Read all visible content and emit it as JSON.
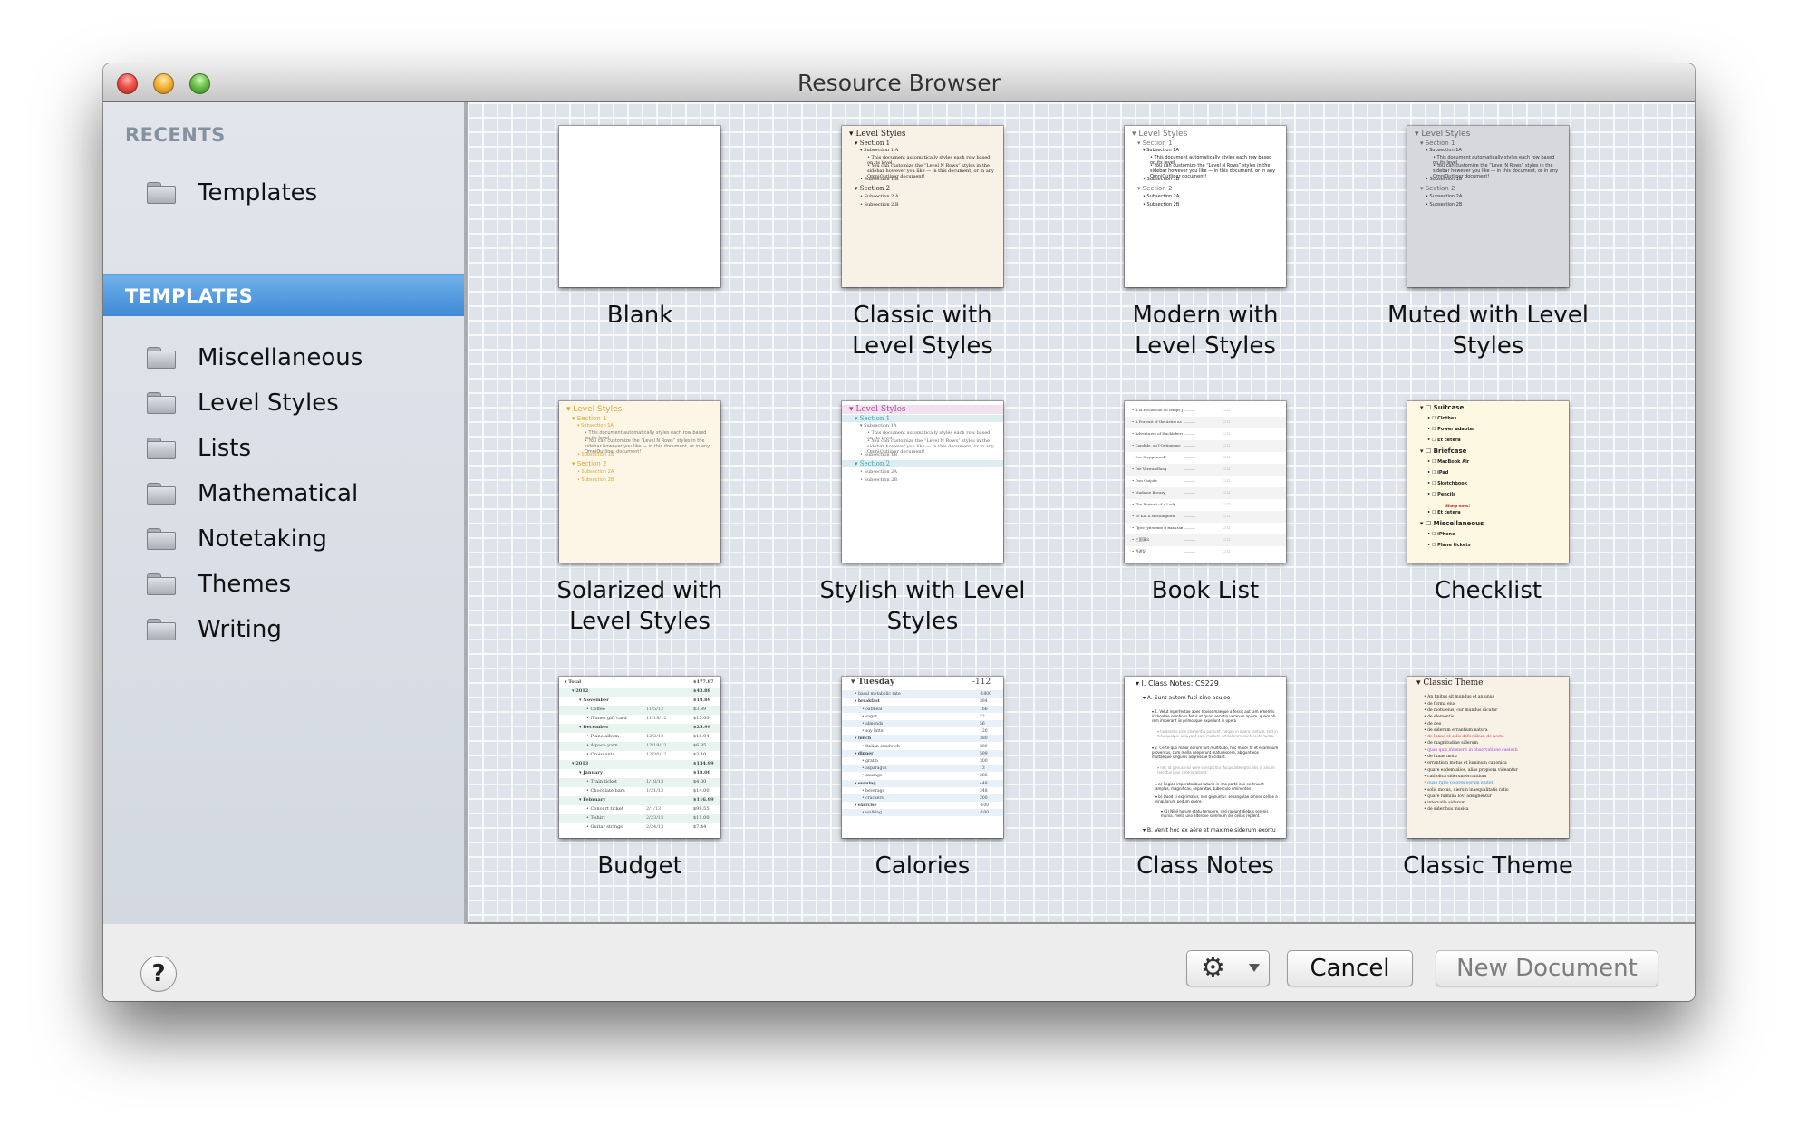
{
  "window": {
    "title": "Resource Browser"
  },
  "sidebar": {
    "recents_header": "RECENTS",
    "recents": [
      {
        "label": "Templates",
        "icon": "folder-icon"
      }
    ],
    "templates_header": "TEMPLATES",
    "templates_selected": true,
    "items": [
      {
        "label": "Miscellaneous",
        "icon": "folder-icon"
      },
      {
        "label": "Level Styles",
        "icon": "folder-icon"
      },
      {
        "label": "Lists",
        "icon": "folder-icon"
      },
      {
        "label": "Mathematical",
        "icon": "folder-icon"
      },
      {
        "label": "Notetaking",
        "icon": "folder-icon"
      },
      {
        "label": "Themes",
        "icon": "folder-icon"
      },
      {
        "label": "Writing",
        "icon": "folder-icon"
      }
    ]
  },
  "templates": [
    {
      "label": "Blank",
      "bg": "#ffffff"
    },
    {
      "label": "Classic with Level Styles",
      "bg": "#f7f1e6",
      "preview": [
        "Level Styles",
        "Section 1",
        "Subsection 1.A",
        "This document automatically styles each row based on its level.",
        "You can customize the “Level N Rows” styles in the sidebar however you like — in this document, or in any OmniOutliner document!",
        "Subsection 1.B",
        "Section 2",
        "Subsection 2.A",
        "Subsection 2.B"
      ]
    },
    {
      "label": "Modern with Level Styles",
      "bg": "#ffffff",
      "preview": [
        "Level Styles",
        "Section 1",
        "Subsection 1A",
        "This document automatically styles each row based on its level.",
        "You can customize the “Level N Rows” styles in the sidebar however you like — in this document, or in any OmniOutliner document!",
        "Subsection 1B",
        "Section 2",
        "Subsection 2A",
        "Subsection 2B"
      ]
    },
    {
      "label": "Muted with Level Styles",
      "bg": "#d6d8dc",
      "preview": [
        "Level Styles",
        "Section 1",
        "Subsection 1A",
        "This document automatically styles each row based on its level.",
        "You can customize the “Level N Rows” styles in the sidebar however you like — in this document, or in any OmniOutliner document!",
        "Subsection 1B",
        "Section 2",
        "Subsection 2A",
        "Subsection 2B"
      ]
    },
    {
      "label": "Solarized with Level Styles",
      "bg": "#fdf6e6",
      "preview": [
        "Level Styles",
        "Section 1",
        "Subsection 1A",
        "This document automatically styles each row based on its level.",
        "You can customize the “Level N Rows” styles in the sidebar however you like — in this document, or in any OmniOutliner document!",
        "Subsection 1B",
        "Section 2",
        "Subsection 2A",
        "Subsection 2B"
      ]
    },
    {
      "label": "Stylish with Level Styles",
      "bg": "#ffffff",
      "preview": [
        "Level Styles",
        "Section 1",
        "Subsection 1A",
        "This document automatically styles each row based on its level.",
        "You can customize the “Level N Rows” styles in the sidebar however you like — in this document, or in any OmniOutliner document!",
        "Subsection 1B",
        "Section 2",
        "Subsection 2A",
        "Subsection 2B"
      ]
    },
    {
      "label": "Book List",
      "bg": "#ffffff",
      "preview": [
        "À la recherche du temps perdu",
        "A Portrait of the Artist as a Young Man",
        "Adventures of Huckleberry Finn",
        "Candide, ou l'Optimisme",
        "Der Steppenwolf",
        "Die Verwandlung",
        "Don Quijote",
        "Madame Bovary",
        "The Portrait of a Lady",
        "To Kill a Mockingbird",
        "Преступление и наказание",
        "三国演义",
        "西遊記"
      ]
    },
    {
      "label": "Checklist",
      "bg": "#fdf8e1",
      "preview": [
        "Suitcase",
        "Clothes",
        "Power adapter",
        "Et cetera",
        "Briefcase",
        "MacBook Air",
        "iPad",
        "Sketchbook",
        "Pencils",
        "Sharp ones!",
        "Et cetera",
        "Miscellaneous",
        "iPhone",
        "Plane tickets"
      ]
    },
    {
      "label": "Budget",
      "bg": "#ffffff",
      "preview": [
        {
          "item": "Total",
          "date": "",
          "amount": "$177.87"
        },
        {
          "item": "2012",
          "date": "",
          "amount": "$43.88"
        },
        {
          "item": "November",
          "date": "",
          "amount": "$18.89"
        },
        {
          "item": "Coffee",
          "date": "11/5/12",
          "amount": "$3.89"
        },
        {
          "item": "iTunes gift card",
          "date": "11/18/12",
          "amount": "$15.00"
        },
        {
          "item": "December",
          "date": "",
          "amount": "$25.99"
        },
        {
          "item": "Piano album",
          "date": "12/2/12",
          "amount": "$18.04"
        },
        {
          "item": "Alpaca yarn",
          "date": "12/19/12",
          "amount": "$6.85"
        },
        {
          "item": "Croissants",
          "date": "12/30/12",
          "amount": "$3.10"
        },
        {
          "item": "2013",
          "date": "",
          "amount": "$134.99"
        },
        {
          "item": "January",
          "date": "",
          "amount": "$18.00"
        },
        {
          "item": "Train ticket",
          "date": "1/18/13",
          "amount": "$4.00"
        },
        {
          "item": "Chocolate bars",
          "date": "1/21/13",
          "amount": "$14.00"
        },
        {
          "item": "February",
          "date": "",
          "amount": "$116.99"
        },
        {
          "item": "Concert ticket",
          "date": "2/1/13",
          "amount": "$98.55"
        },
        {
          "item": "T-shirt",
          "date": "2/23/13",
          "amount": "$11.00"
        },
        {
          "item": "Guitar strings",
          "date": "2/24/13",
          "amount": "$7.44"
        }
      ]
    },
    {
      "label": "Calories",
      "bg": "#ffffff",
      "preview": [
        {
          "item": "Tuesday",
          "value": "-112"
        },
        {
          "item": "basal metabolic rate",
          "value": "-1800"
        },
        {
          "item": "breakfast",
          "value": "384"
        },
        {
          "item": "oatmeal",
          "value": "166"
        },
        {
          "item": "sugar",
          "value": "22"
        },
        {
          "item": "almonds",
          "value": "56"
        },
        {
          "item": "soy latte",
          "value": "120"
        },
        {
          "item": "lunch",
          "value": "380"
        },
        {
          "item": "Italian sandwich",
          "value": "380"
        },
        {
          "item": "dinner",
          "value": "599"
        },
        {
          "item": "gratin",
          "value": "300"
        },
        {
          "item": "asparagus",
          "value": "13"
        },
        {
          "item": "sausage",
          "value": "286"
        },
        {
          "item": "evening",
          "value": "448"
        },
        {
          "item": "beverage",
          "value": "248"
        },
        {
          "item": "crackers",
          "value": "200"
        },
        {
          "item": "exercise",
          "value": "-100"
        },
        {
          "item": "walking",
          "value": "-100"
        }
      ]
    },
    {
      "label": "Class Notes",
      "bg": "#ffffff",
      "preview": [
        "I. Class Notes: CS229",
        "A. Sunt autem fuci sine aculeo",
        "1. Velut inperfectae apes novissimaeque a fessis aut iam emeritis inchoatae serotinus fetus et quasi servitia verarum apium, quam ob rem imperant iis primosque expellunt in opera",
        "tardantes sine clementia puniunt. neque in opere tantum, sed in fetu quoque adiuvant eas, multum ad calorem conferente turba.",
        "2. Certe quo maior eorum fuit multitudo, hoc maior fit et examinum proventus, cum mella coeperunt maturescere, abigunt eos multaeque singulos adgressae trucidant.",
        "nec id genus nisi vere conspicitur. fucus ademptis alis in alvum relectus ipse ceteris adimit.",
        "a) Regias imperatoribus futuris in ima parte alvi exstruunt amplas, magnificas, separatas, tuberculo eminentes",
        "b) Quod si exprimatur, non gignuntur. sexangulae omnes cellae a singulorum pedum opere.",
        "(1) Nihil horum statu tempore, sed rapiunt diebus serenis munia, mella uno alterove summum die cellas replent.",
        "B. Venit hoc ex aëre et maxime siderum exortu"
      ]
    },
    {
      "label": "Classic Theme",
      "bg": "#f7f1e6",
      "preview": [
        "Classic Theme",
        "An finitus sit mundus et an unus",
        "de forma eius",
        "de motu eius, cur mundus dicatur",
        "de elementis",
        "de deo",
        "de siderum errantium natura",
        "de lunae et solis defectibus, de nocte",
        "de magnitudine siderum",
        "quae quis invenerit in observatione caelesti",
        "de lunae motu",
        "errantium motus et luminum canonica",
        "quare eadem alios, alias propiora videantur",
        "catholica siderum errantium",
        "quae ratio colores eorum mutet",
        "solis motus, dierum inaequalitatis ratio",
        "quare fulmina Iovi adsignentur",
        "intervalla siderum",
        "de sideribus musica"
      ]
    }
  ],
  "footer": {
    "help_label": "?",
    "gear_icon": "gear-icon",
    "cancel_label": "Cancel",
    "new_document_label": "New Document",
    "new_document_enabled": false
  },
  "colors": {
    "selection": "#4a93dc",
    "solarized_accent": "#d9a62c",
    "stylish_title": "#b6459f",
    "stylish_section": "#36a3b0",
    "checklist_note": "#cc2222",
    "classic_red": "#e0363a",
    "classic_purple": "#a142e8",
    "classic_blue": "#2d8de4"
  }
}
